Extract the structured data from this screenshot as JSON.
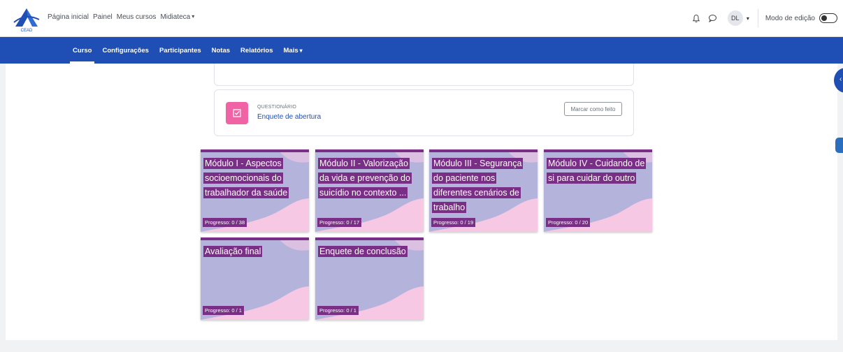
{
  "brand": {
    "logo_text": "CEAD"
  },
  "topnav": {
    "items": [
      "Página inicial",
      "Painel",
      "Meus cursos",
      "Midiateca"
    ]
  },
  "user": {
    "initials": "DL",
    "edit_mode_label": "Modo de edição",
    "edit_mode_on": false
  },
  "secnav": {
    "items": [
      "Curso",
      "Configurações",
      "Participantes",
      "Notas",
      "Relatórios",
      "Mais"
    ],
    "active": "Curso"
  },
  "activity": {
    "type": "QUESTIONÁRIO",
    "name": "Enquete de abertura",
    "mark_done_label": "Marcar como feito"
  },
  "modules": [
    {
      "title": "Módulo I - Aspectos socioemocionais do trabalhador da saúde",
      "progress": "Progresso: 0 / 38"
    },
    {
      "title": "Módulo II - Valorização da vida e prevenção do suicídio no contexto ...",
      "progress": "Progresso: 0 / 17"
    },
    {
      "title": "Módulo III - Segurança do paciente nos diferentes cenários de trabalho",
      "progress": "Progresso: 0 / 19"
    },
    {
      "title": "Módulo IV - Cuidando de si para cuidar do outro",
      "progress": "Progresso: 0 / 20"
    },
    {
      "title": "Avaliação final",
      "progress": "Progresso: 0 / 1"
    },
    {
      "title": "Enquete de conclusão",
      "progress": "Progresso: 0 / 1"
    }
  ],
  "colors": {
    "primary": "#1f4fb5",
    "card_purple": "#7a2f86",
    "card_lavender": "#b4b3dc",
    "card_pink": "#f6c8e4",
    "activity_icon": "#f064a6"
  }
}
